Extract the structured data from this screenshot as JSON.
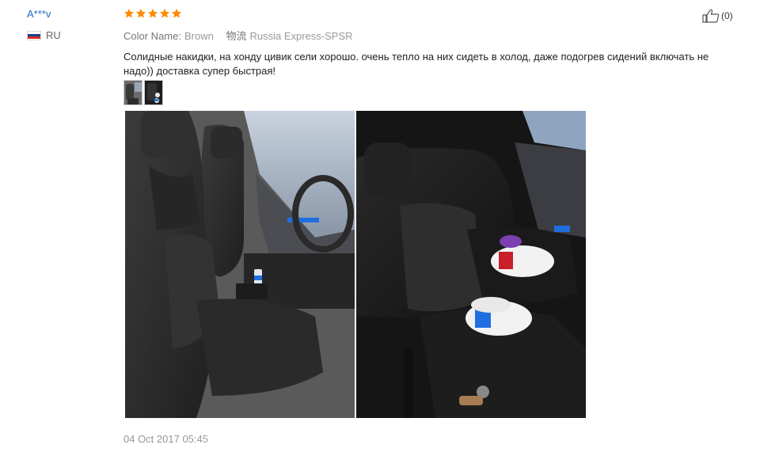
{
  "review": {
    "username": "A***v",
    "country_code": "RU",
    "rating": 5,
    "star_color": "#ff8a00",
    "color_label": "Color Name:",
    "color_value": "Brown",
    "shipping_label": "物流",
    "shipping_value": "Russia Express-SPSR",
    "text": "Солидные накидки, на хонду цивик сели хорошо. очень тепло на них сидеть в холод, даже подогрев сидений включать не надо)) доставка супер быстрая!",
    "date": "04 Oct 2017 05:45",
    "helpful_count": "(0)"
  },
  "icons": {
    "flag": "russia-flag-icon",
    "thumbs_up": "thumbs-up-icon",
    "star": "star-icon"
  }
}
